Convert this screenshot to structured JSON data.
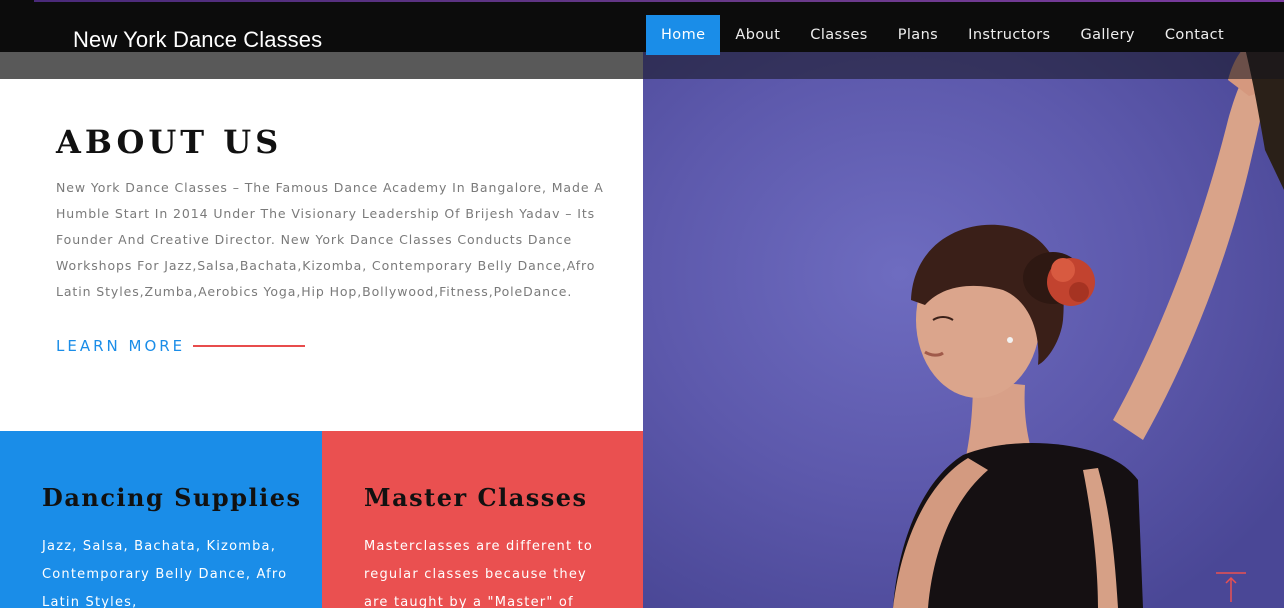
{
  "header": {
    "brand": "New York Dance Classes",
    "nav": [
      {
        "label": "Home",
        "active": true
      },
      {
        "label": "About",
        "active": false
      },
      {
        "label": "Classes",
        "active": false
      },
      {
        "label": "Plans",
        "active": false
      },
      {
        "label": "Instructors",
        "active": false
      },
      {
        "label": "Gallery",
        "active": false
      },
      {
        "label": "Contact",
        "active": false
      }
    ]
  },
  "about": {
    "title": "ABOUT US",
    "text": "New York Dance Classes – The Famous Dance Academy In Bangalore, Made A Humble Start In 2014 Under The Visionary Leadership Of Brijesh Yadav – Its Founder And Creative Director. New York Dance Classes Conducts Dance Workshops For Jazz,Salsa,Bachata,Kizomba, Contemporary Belly Dance,Afro Latin Styles,Zumba,Aerobics Yoga,Hip Hop,Bollywood,Fitness,PoleDance.",
    "learn_more": "LEARN MORE"
  },
  "cards": [
    {
      "title": "Dancing Supplies",
      "text": "Jazz, Salsa, Bachata, Kizomba, Contemporary Belly Dance, Afro Latin Styles,"
    },
    {
      "title": "Master Classes",
      "text": "Masterclasses are different to regular classes because they are taught by a \"Master\" of"
    }
  ],
  "icons": {
    "scroll_top": "arrow-up-icon"
  },
  "colors": {
    "accent_blue": "#1a8de8",
    "accent_red": "#ea5050",
    "photo_bg": "#5d59ac"
  }
}
